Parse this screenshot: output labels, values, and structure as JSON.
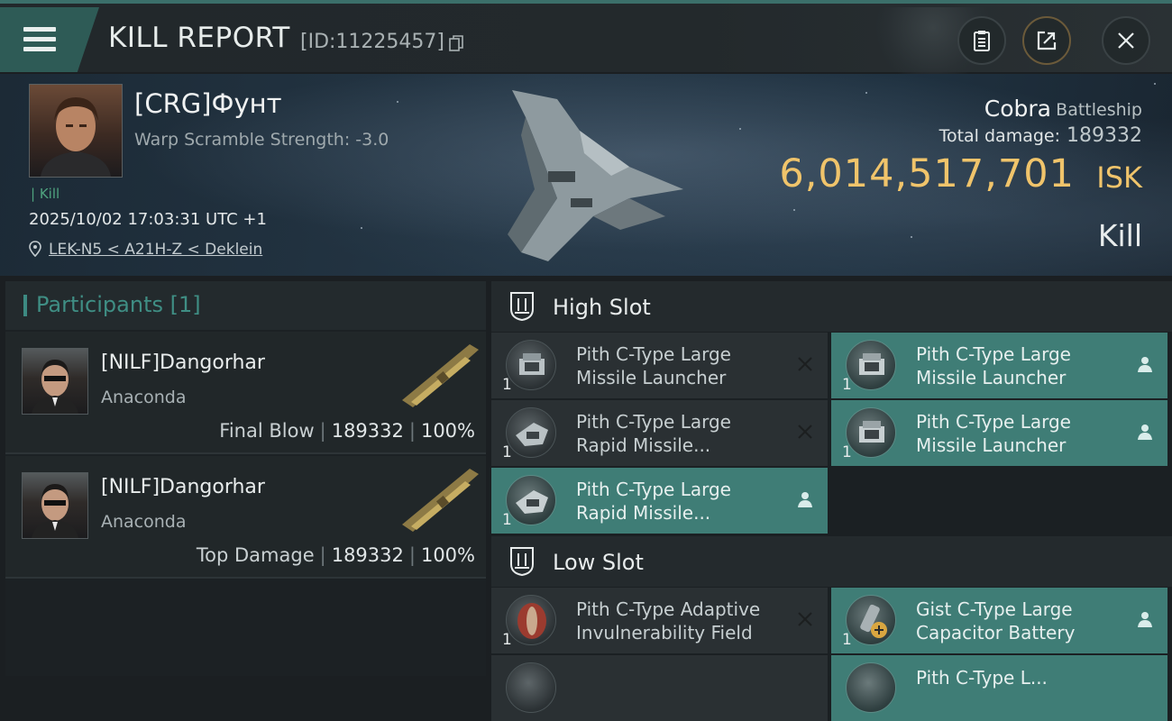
{
  "header": {
    "title": "KILL REPORT",
    "report_id": "[ID:11225457]"
  },
  "victim": {
    "name": "[CRG]Фунт",
    "warp_scramble": "Warp Scramble Strength: -3.0",
    "tag": "Kill",
    "time": "2025/10/02 17:03:31 UTC +1",
    "location": "LEK-N5 < A21H-Z < Deklein",
    "ship_name": "Cobra",
    "ship_class": "Battleship",
    "damage_label": "Total damage:",
    "damage_value": "189332",
    "isk_value": "6,014,517,701",
    "isk_unit": "ISK",
    "result": "Kill"
  },
  "participants": {
    "title": "Participants [1]",
    "rows": [
      {
        "name": "[NILF]Dangorhar",
        "ship": "Anaconda",
        "role": "Final Blow",
        "damage": "189332",
        "percent": "100%"
      },
      {
        "name": "[NILF]Dangorhar",
        "ship": "Anaconda",
        "role": "Top Damage",
        "damage": "189332",
        "percent": "100%"
      }
    ]
  },
  "slots": {
    "high": {
      "title": "High Slot",
      "modules": [
        {
          "line1": "Pith C-Type Large",
          "line2": "Missile Launcher",
          "qty": "1",
          "status": "destroyed"
        },
        {
          "line1": "Pith C-Type Large",
          "line2": "Missile Launcher",
          "qty": "1",
          "status": "dropped"
        },
        {
          "line1": "Pith C-Type Large",
          "line2": "Rapid Missile...",
          "qty": "1",
          "status": "destroyed"
        },
        {
          "line1": "Pith C-Type Large",
          "line2": "Missile Launcher",
          "qty": "1",
          "status": "dropped"
        },
        {
          "line1": "Pith C-Type Large",
          "line2": "Rapid Missile...",
          "qty": "1",
          "status": "dropped"
        }
      ]
    },
    "low": {
      "title": "Low Slot",
      "modules": [
        {
          "line1": "Pith C-Type Adaptive",
          "line2": "Invulnerability Field",
          "qty": "1",
          "status": "destroyed"
        },
        {
          "line1": "Gist C-Type Large",
          "line2": "Capacitor Battery",
          "qty": "1",
          "status": "dropped"
        },
        {
          "line1": "",
          "line2": "",
          "qty": "",
          "status": "destroyed"
        },
        {
          "line1": "Pith C-Type L...",
          "line2": "",
          "qty": "",
          "status": "dropped"
        }
      ]
    }
  },
  "colors": {
    "accent_teal": "#3f7d76",
    "isk_gold": "#f0c46b",
    "kill_green": "#4fa37f"
  }
}
